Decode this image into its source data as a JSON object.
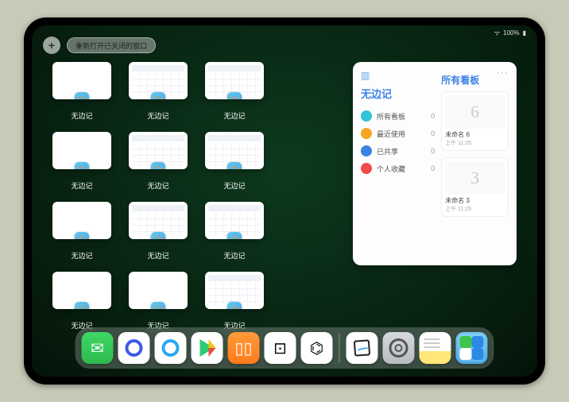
{
  "status": {
    "signal": "••••",
    "battery": "100%"
  },
  "topbar": {
    "plus": "+",
    "reopen": "重新打开已关闭的窗口"
  },
  "thumb_label": "无边记",
  "thumbs": [
    {
      "cal": false
    },
    {
      "cal": true
    },
    {
      "cal": true
    },
    null,
    {
      "cal": false
    },
    {
      "cal": true
    },
    {
      "cal": true
    },
    null,
    {
      "cal": false
    },
    {
      "cal": true
    },
    {
      "cal": true
    },
    null,
    {
      "cal": false
    },
    {
      "cal": false
    },
    {
      "cal": true
    }
  ],
  "panel": {
    "left_title": "无边记",
    "right_title": "所有看板",
    "more": "···",
    "categories": [
      {
        "color": "c-cyan",
        "label": "所有看板",
        "count": "0"
      },
      {
        "color": "c-orange",
        "label": "最近使用",
        "count": "0"
      },
      {
        "color": "c-blue",
        "label": "已共享",
        "count": "0"
      },
      {
        "color": "c-red",
        "label": "个人收藏",
        "count": "0"
      }
    ],
    "boards": [
      {
        "glyph": "6",
        "name": "未命名 6",
        "date": "上午 11:25"
      },
      {
        "glyph": "3",
        "name": "未命名 3",
        "date": "上午 11:25"
      }
    ]
  },
  "dock": [
    {
      "cls": "i-wechat",
      "name": "wechat-icon"
    },
    {
      "cls": "i-quark",
      "name": "quark-icon"
    },
    {
      "cls": "i-qqbrowser",
      "name": "qqbrowser-icon"
    },
    {
      "cls": "i-play",
      "name": "play-icon"
    },
    {
      "cls": "i-books",
      "name": "books-icon"
    },
    {
      "cls": "i-dice",
      "name": "dice-icon"
    },
    {
      "cls": "i-pods",
      "name": "airpods-icon"
    },
    {
      "sep": true
    },
    {
      "cls": "i-freeform",
      "name": "freeform-icon"
    },
    {
      "cls": "i-settings",
      "name": "settings-icon"
    },
    {
      "cls": "i-notes",
      "name": "notes-icon"
    },
    {
      "cls": "i-folder",
      "name": "app-folder-icon"
    }
  ]
}
